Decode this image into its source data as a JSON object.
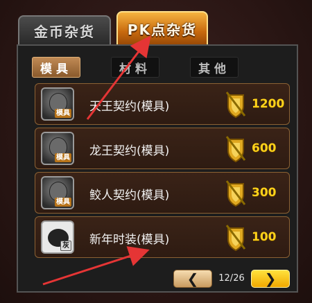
{
  "main_tabs": [
    {
      "label": "金币杂货",
      "active": false
    },
    {
      "label": "PK点杂货",
      "active": true
    }
  ],
  "sub_tabs": [
    {
      "label": "模具",
      "active": true
    },
    {
      "label": "材料",
      "active": false
    },
    {
      "label": "其他",
      "active": false
    }
  ],
  "items": [
    {
      "name": "天王契约(模具)",
      "icon_tag": "模具",
      "price": "1200",
      "icon": "tianwang-portrait-icon"
    },
    {
      "name": "龙王契约(模具)",
      "icon_tag": "模具",
      "price": "600",
      "icon": "longwang-portrait-icon"
    },
    {
      "name": "鲛人契约(模具)",
      "icon_tag": "模具",
      "price": "300",
      "icon": "jiaoren-portrait-icon"
    },
    {
      "name": "新年时装(模具)",
      "icon_tag": "灰",
      "price": "100",
      "icon": "new-year-costume-icon"
    }
  ],
  "currency_icon": "gold-shield-sword-icon",
  "pager": {
    "prev_label": "❮",
    "next_label": "❯",
    "page_text": "12/26"
  },
  "colors": {
    "active_tab": "#e38a1f",
    "price": "#ffd21a",
    "row_border": "#8c6234",
    "annotation_arrow": "#e53535"
  }
}
